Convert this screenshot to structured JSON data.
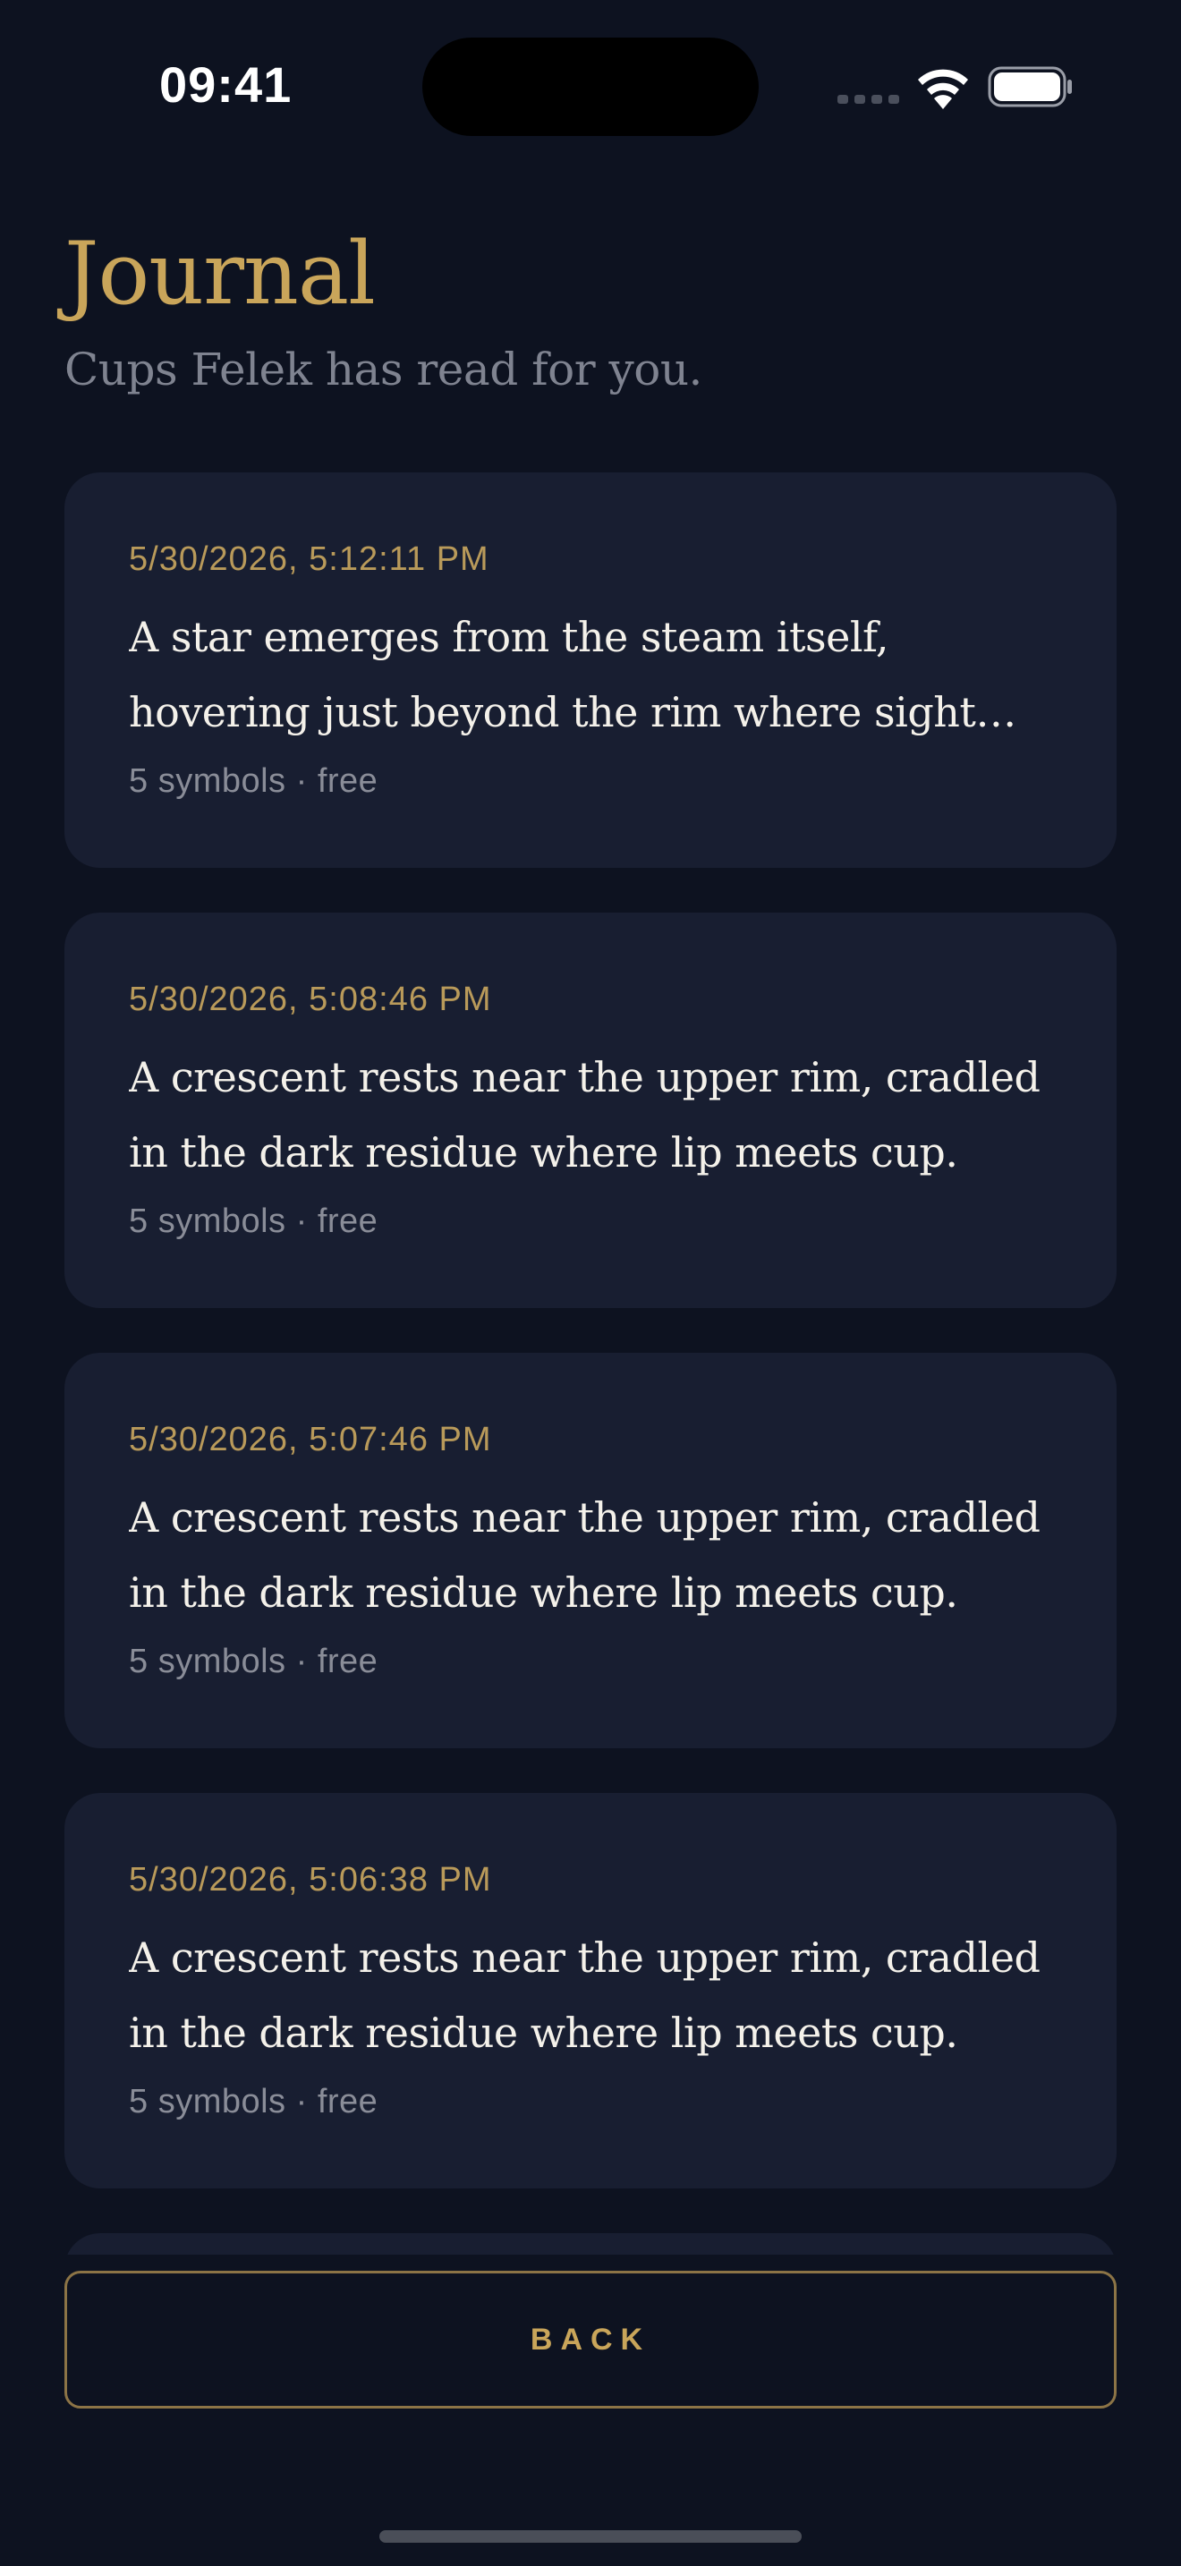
{
  "status_bar": {
    "time": "09:41"
  },
  "header": {
    "title": "Journal",
    "subtitle": "Cups Felek has read for you."
  },
  "entries": [
    {
      "date": "5/30/2026, 5:12:11 PM",
      "text": "A star emerges from the steam itself, hovering just beyond the rim where sight fades into suggestion.",
      "meta": "5 symbols · free"
    },
    {
      "date": "5/30/2026, 5:08:46 PM",
      "text": "A crescent rests near the upper rim, cradled in the dark residue where lip meets cup.",
      "meta": "5 symbols · free"
    },
    {
      "date": "5/30/2026, 5:07:46 PM",
      "text": "A crescent rests near the upper rim, cradled in the dark residue where lip meets cup.",
      "meta": "5 symbols · free"
    },
    {
      "date": "5/30/2026, 5:06:38 PM",
      "text": "A crescent rests near the upper rim, cradled in the dark residue where lip meets cup.",
      "meta": "5 symbols · free"
    }
  ],
  "back_button": {
    "label": "BACK"
  },
  "colors": {
    "background": "#0d1220",
    "card": "#181e31",
    "accent_gold": "#c9a55a",
    "muted_text": "#8a8d98"
  },
  "icons": [
    "signal-icon",
    "wifi-icon",
    "battery-icon"
  ]
}
